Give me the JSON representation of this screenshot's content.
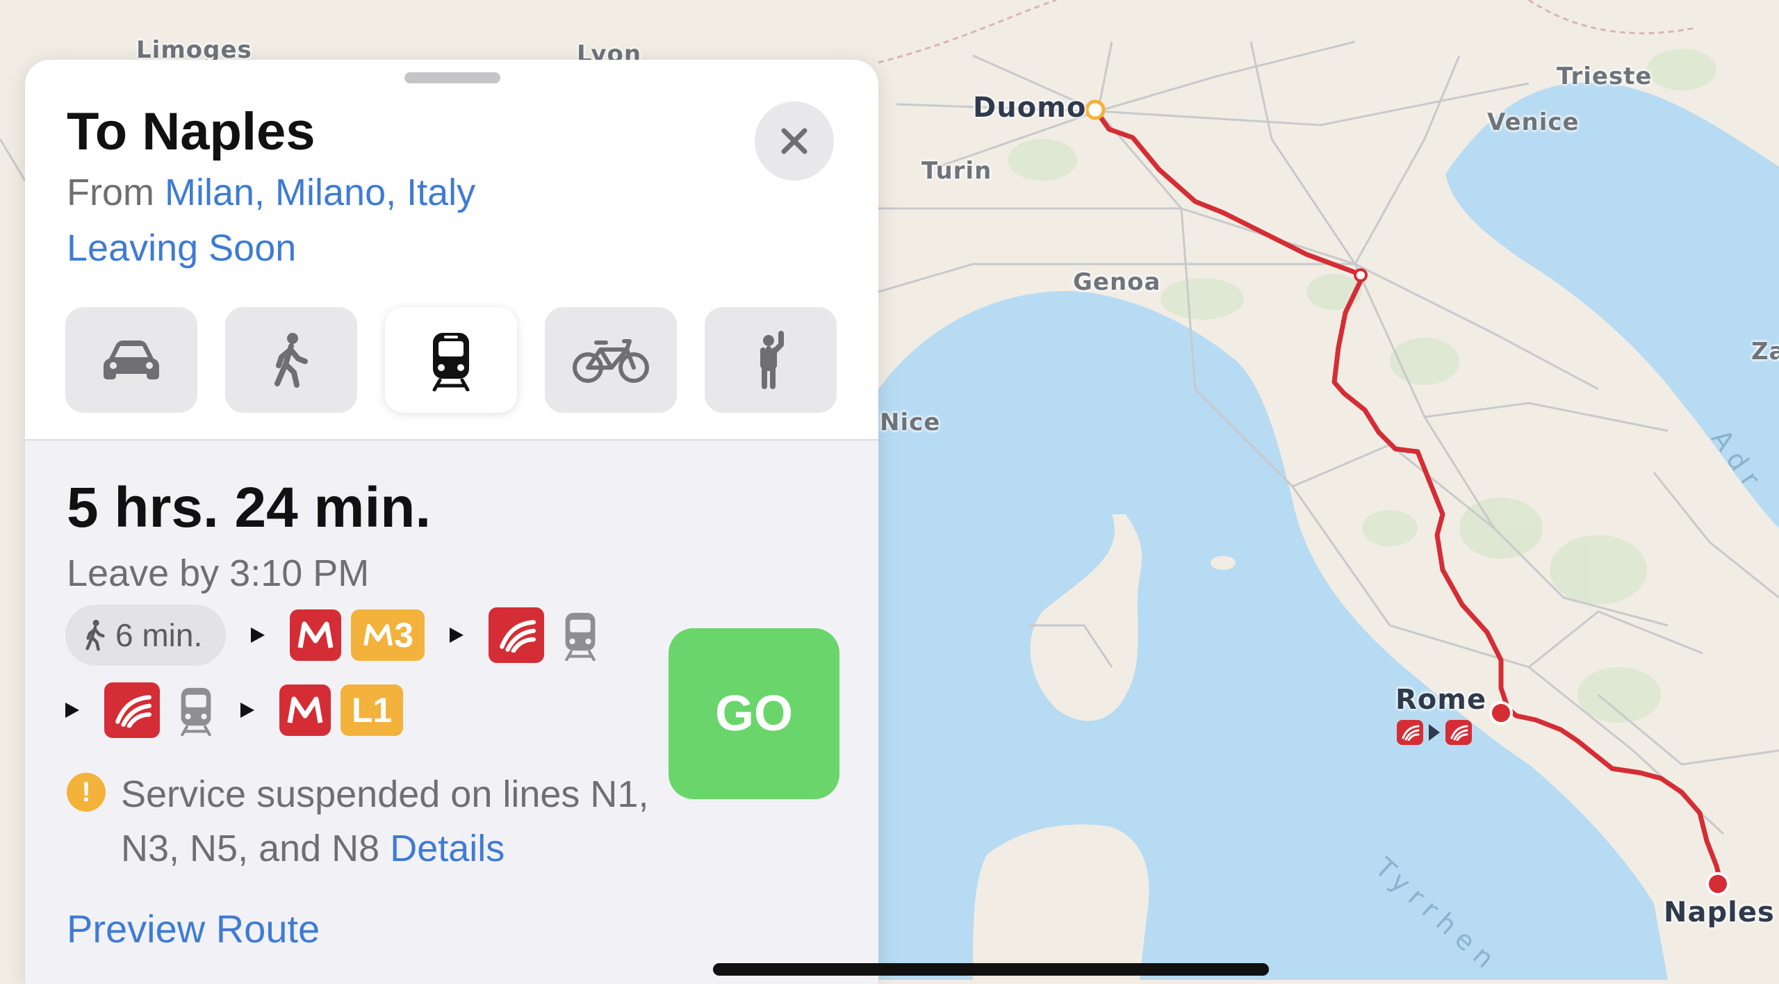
{
  "map": {
    "labels": {
      "limoges": "Limoges",
      "lyon": "Lyon",
      "trieste": "Trieste",
      "venice": "Venice",
      "turin": "Turin",
      "genoa": "Genoa",
      "nice": "Nice",
      "za": "Za",
      "adriatic": "Adr",
      "tyrrhenian": "Tyrrhen"
    },
    "origin_label": "Duomo",
    "stop_label": "Rome",
    "destination_label": "Naples",
    "route_color": "#d52d35",
    "water_color": "#b7dbf2",
    "land_color": "#f1ede4"
  },
  "panel": {
    "title": "To Naples",
    "from_prefix": "From",
    "from_place": "Milan, Milano, Italy",
    "leaving": "Leaving Soon",
    "close_icon": "close-icon",
    "modes": [
      {
        "name": "drive",
        "icon": "car-icon",
        "selected": false
      },
      {
        "name": "walk",
        "icon": "walking-person-icon",
        "selected": false
      },
      {
        "name": "transit",
        "icon": "train-icon",
        "selected": true
      },
      {
        "name": "cycle",
        "icon": "bicycle-icon",
        "selected": false
      },
      {
        "name": "ride",
        "icon": "hailing-person-icon",
        "selected": false
      }
    ]
  },
  "route": {
    "duration": "5 hrs. 24 min.",
    "leave_by": "Leave by 3:10 PM",
    "walk_time": "6 min.",
    "metro_m3": "M3",
    "line_l1": "L1",
    "warning_text": "Service suspended on lines N1, N3, N5, and N8",
    "details_link": "Details",
    "go_label": "GO",
    "preview_label": "Preview Route"
  },
  "colors": {
    "accent_blue": "#3e7bd4",
    "go_green": "#6ad56b",
    "metro_red": "#d52d35",
    "metro_yellow": "#f3b23b"
  }
}
